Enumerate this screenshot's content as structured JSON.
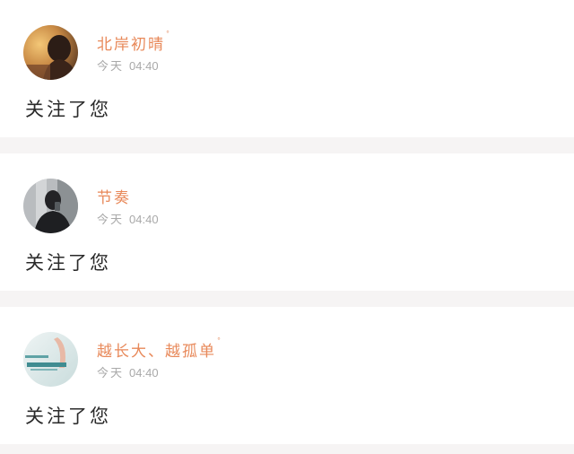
{
  "notifications": [
    {
      "username": "北岸初晴",
      "vip_mark": "°",
      "day": "今天",
      "time": "04:40",
      "message": "关注了您",
      "avatar_icon": "avatar-person-warm-light"
    },
    {
      "username": "节奏",
      "vip_mark": "",
      "day": "今天",
      "time": "04:40",
      "message": "关注了您",
      "avatar_icon": "avatar-person-mirror-selfie"
    },
    {
      "username": "越长大、越孤单",
      "vip_mark": "°",
      "day": "今天",
      "time": "04:40",
      "message": "关注了您",
      "avatar_icon": "avatar-text-art"
    }
  ],
  "colors": {
    "username": "#e8895a",
    "meta": "#a9a9a9",
    "message": "#2a2a2a",
    "separator": "#f6f4f4"
  }
}
